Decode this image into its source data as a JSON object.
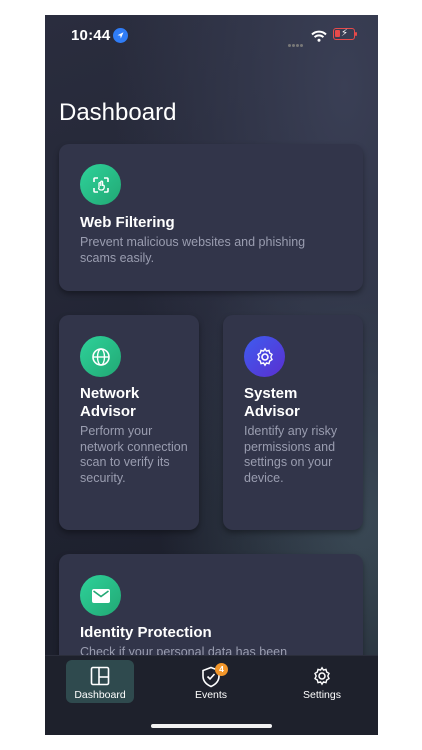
{
  "status_bar": {
    "time": "10:44"
  },
  "header": {
    "title": "Dashboard"
  },
  "cards": [
    {
      "title": "Web Filtering",
      "description": "Prevent malicious websites and phishing scams easily."
    },
    {
      "title": "Network Advisor",
      "description": "Perform your network connection scan to verify its security."
    },
    {
      "title": "System Advisor",
      "description": "Identify any risky permissions and settings on your device."
    },
    {
      "title": "Identity Protection",
      "description": "Check if your personal data has been"
    }
  ],
  "tabs": [
    {
      "label": "Dashboard",
      "icon": "dashboard-icon",
      "active": true
    },
    {
      "label": "Events",
      "icon": "shield-icon",
      "badge": "4"
    },
    {
      "label": "Settings",
      "icon": "gear-icon"
    }
  ],
  "colors": {
    "accent_green": "#22a874",
    "accent_blue": "#3e5cf0",
    "badge_orange": "#f2962a",
    "card_bg": "#32354a"
  }
}
